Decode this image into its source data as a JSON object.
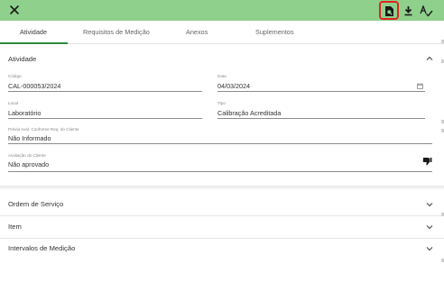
{
  "toolbar": {
    "close_icon": "close-icon",
    "actions": [
      "document-search-icon",
      "download-icon",
      "spellcheck-icon"
    ],
    "highlight_color": "#e0231f",
    "bar_color": "#8fd08c"
  },
  "tabs": [
    {
      "label": "Atividade",
      "active": true
    },
    {
      "label": "Requisitos de Medição",
      "active": false
    },
    {
      "label": "Anexos",
      "active": false
    },
    {
      "label": "Suplementos",
      "active": false
    }
  ],
  "activity": {
    "title": "Atividade",
    "codigo": {
      "label": "Código",
      "value": "CAL-000053/2024"
    },
    "data": {
      "label": "Data",
      "value": "04/03/2024"
    },
    "local": {
      "label": "Local",
      "value": "Laboratório"
    },
    "tipo": {
      "label": "Tipo",
      "value": "Calibração Acreditada"
    },
    "previa": {
      "label": "Prévia Aval. Conforme Req. do Cliente",
      "value": "Não Informado"
    },
    "avaliacao": {
      "label": "Avaliação do Cliente",
      "value": "Não aprovado"
    }
  },
  "sections": [
    {
      "title": "Ordem de Serviço"
    },
    {
      "title": "Item"
    },
    {
      "title": "Intervalos de Medição"
    }
  ]
}
